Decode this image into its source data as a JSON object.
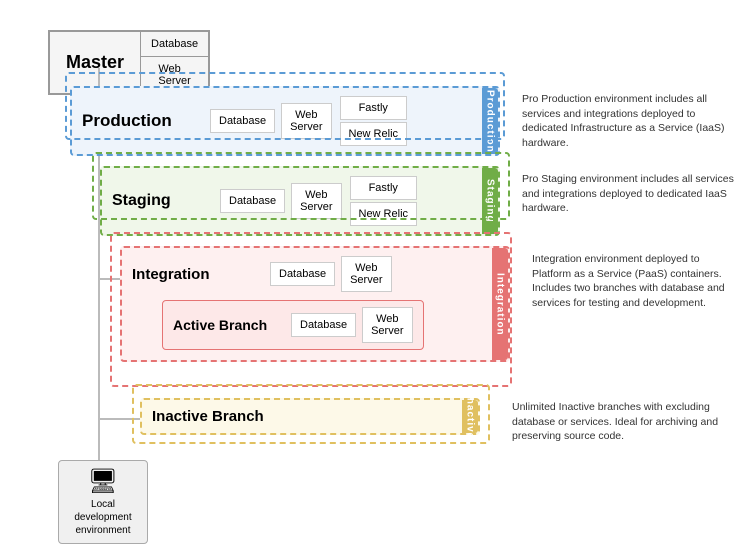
{
  "master": {
    "label": "Master",
    "components": [
      "Database",
      "Web Server"
    ]
  },
  "production": {
    "label": "Production",
    "components": [
      "Database",
      "Web Server"
    ],
    "right_components": [
      "Fastly",
      "New Relic"
    ],
    "description": "Pro Production environment includes all services and integrations deployed to dedicated Infrastructure as a Service (IaaS) hardware.",
    "side_label": "Production"
  },
  "staging": {
    "label": "Staging",
    "components": [
      "Database",
      "Web Server"
    ],
    "right_components": [
      "Fastly",
      "New Relic"
    ],
    "description": "Pro Staging environment includes all services and integrations deployed to dedicated IaaS hardware.",
    "side_label": "Staging"
  },
  "integration": {
    "label": "Integration",
    "components": [
      "Database",
      "Web Server"
    ],
    "description": "Integration environment deployed to Platform as a Service (PaaS) containers. Includes two branches with database and services for testing and development.",
    "side_label": "Integration"
  },
  "active_branch": {
    "label": "Active Branch",
    "components": [
      "Database",
      "Web Server"
    ]
  },
  "inactive_branch": {
    "label": "Inactive Branch",
    "description": "Unlimited Inactive branches with excluding database or services. Ideal for archiving and preserving source code.",
    "side_label": "Inactive"
  },
  "local_dev": {
    "label": "Local development environment",
    "icon": "🖥"
  }
}
